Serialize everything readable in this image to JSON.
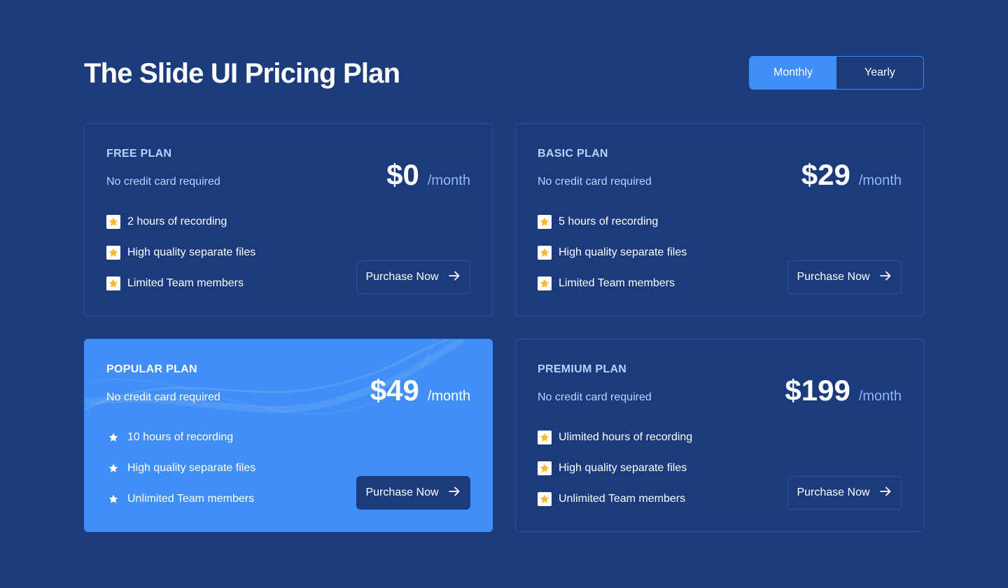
{
  "header": {
    "title": "The Slide UI Pricing Plan"
  },
  "billing_toggle": {
    "monthly_label": "Monthly",
    "yearly_label": "Yearly",
    "selected": "Monthly"
  },
  "theme": {
    "background": "#1c3b7c",
    "accent": "#3f8ff6",
    "star": "#f5b82e"
  },
  "plans": [
    {
      "name": "FREE PLAN",
      "subtitle": "No credit card required",
      "price": "$0",
      "period": "/month",
      "features": [
        "2 hours of recording",
        "High quality separate files",
        "Limited Team members"
      ],
      "button_label": "Purchase Now",
      "icons": {
        "feature": "star-icon",
        "button": "arrow-right-icon"
      }
    },
    {
      "name": "BASIC PLAN",
      "subtitle": "No credit card required",
      "price": "$29",
      "period": "/month",
      "features": [
        "5 hours of recording",
        "High quality separate files",
        "Limited Team members"
      ],
      "button_label": "Purchase Now",
      "icons": {
        "feature": "star-icon",
        "button": "arrow-right-icon"
      }
    },
    {
      "name": "POPULAR PLAN",
      "subtitle": "No credit card required",
      "price": "$49",
      "period": "/month",
      "features": [
        "10 hours of recording",
        "High quality separate files",
        "Unlimited Team members"
      ],
      "button_label": "Purchase Now",
      "highlighted": true,
      "icons": {
        "feature": "star-icon",
        "button": "arrow-right-icon"
      }
    },
    {
      "name": "PREMIUM PLAN",
      "subtitle": "No credit card required",
      "price": "$199",
      "period": "/month",
      "features": [
        "Ulimited hours of recording",
        "High quality separate files",
        "Unlimited Team members"
      ],
      "button_label": "Purchase Now",
      "icons": {
        "feature": "star-icon",
        "button": "arrow-right-icon"
      }
    }
  ]
}
